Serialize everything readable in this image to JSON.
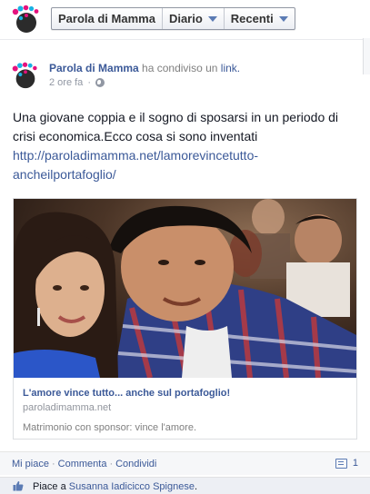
{
  "nav": {
    "items": [
      {
        "label": "Parola di Mamma",
        "dropdown": false
      },
      {
        "label": "Diario",
        "dropdown": true
      },
      {
        "label": "Recenti",
        "dropdown": true
      }
    ]
  },
  "post": {
    "author": "Parola di Mamma",
    "action_prefix": "ha condiviso un",
    "action_link": "link.",
    "time": "2 ore fa",
    "privacy_icon": "globe-icon",
    "message": "Una giovane coppia e il sogno di sposarsi in un periodo di crisi economica.Ecco cosa si sono inventati",
    "url_line1": "http://paroladimamma.net/lamorevincetutto-",
    "url_line2": "ancheilportafoglio/"
  },
  "share": {
    "title": "L'amore vince tutto... anche sul portafoglio!",
    "domain": "paroladimamma.net",
    "description": "Matrimonio con sponsor: vince l'amore."
  },
  "actions": {
    "like": "Mi piace",
    "comment": "Commenta",
    "share": "Condividi",
    "separator": "·",
    "comment_count": "1"
  },
  "likes": {
    "prefix": "Piace a",
    "name": "Susanna Iadicicco Spignese",
    "suffix": "."
  },
  "colors": {
    "link": "#3b5998",
    "meta": "#9197a3",
    "logo_pink": "#e5127e",
    "logo_cyan": "#19b1e3",
    "logo_dark": "#2b2b2b"
  }
}
